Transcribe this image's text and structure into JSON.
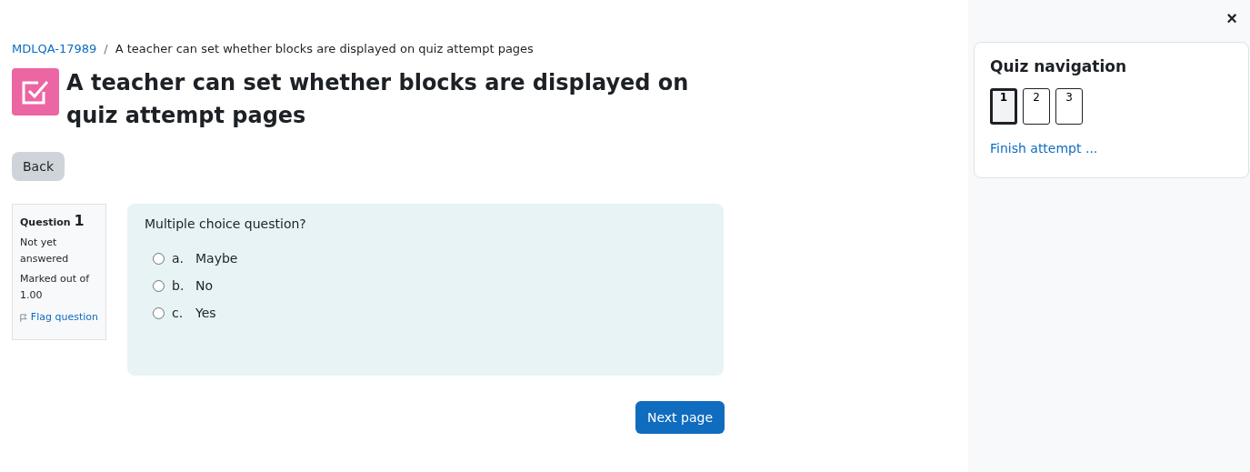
{
  "breadcrumb": [
    {
      "label": "MDLQA-17989",
      "kind": "link"
    },
    {
      "label": "/",
      "kind": "separator"
    },
    {
      "label": "A teacher can set whether blocks are displayed on quiz attempt pages",
      "kind": "text"
    }
  ],
  "title": "A teacher can set whether blocks are displayed on quiz attempt pages",
  "back_button": "Back",
  "question_info": {
    "label": "Question",
    "number": "1",
    "state": "Not yet answered",
    "marks": "Marked out of 1.00",
    "flag": "Flag question"
  },
  "question": {
    "text": "Multiple choice question?",
    "options": [
      {
        "letter": "a.",
        "label": "Maybe",
        "checked": false
      },
      {
        "letter": "b.",
        "label": "No",
        "checked": false
      },
      {
        "letter": "c.",
        "label": "Yes",
        "checked": false
      }
    ]
  },
  "next_button": "Next page",
  "sidebar": {
    "close": "×",
    "title": "Quiz navigation",
    "pages": [
      {
        "label": "1",
        "selected": true
      },
      {
        "label": "2",
        "selected": false
      },
      {
        "label": "3",
        "selected": false
      }
    ],
    "finish": "Finish attempt ..."
  }
}
